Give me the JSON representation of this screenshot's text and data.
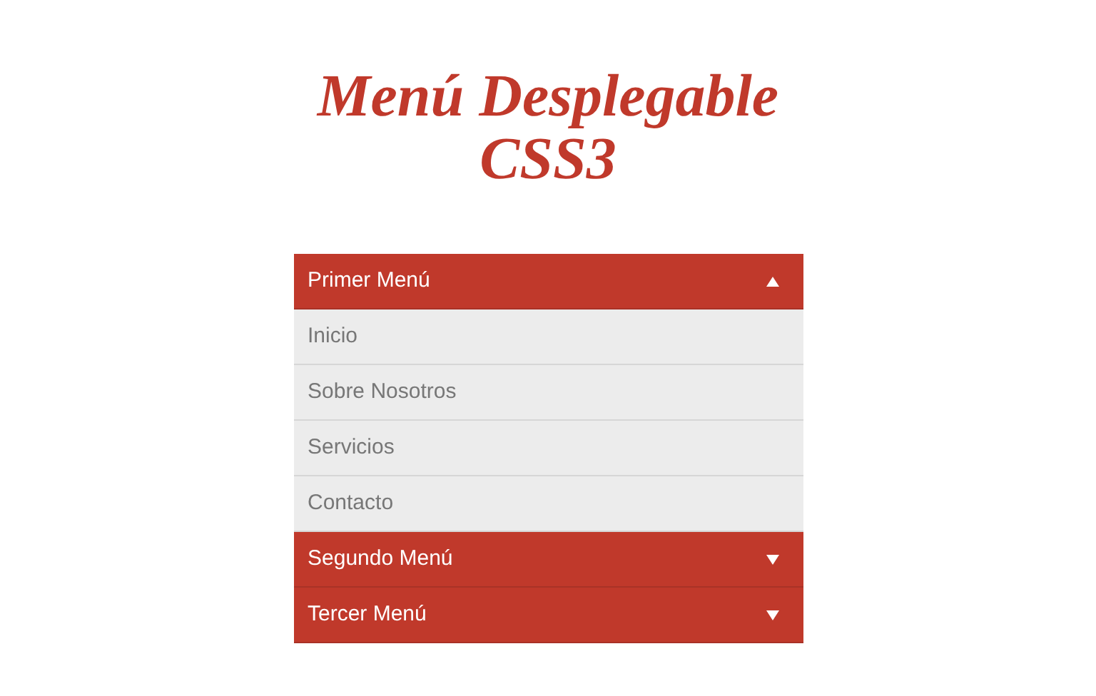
{
  "title": "Menú Desplegable CSS3",
  "menus": [
    {
      "label": "Primer Menú",
      "expanded": true,
      "items": [
        "Inicio",
        "Sobre Nosotros",
        "Servicios",
        "Contacto"
      ]
    },
    {
      "label": "Segundo Menú",
      "expanded": false
    },
    {
      "label": "Tercer Menú",
      "expanded": false
    }
  ]
}
